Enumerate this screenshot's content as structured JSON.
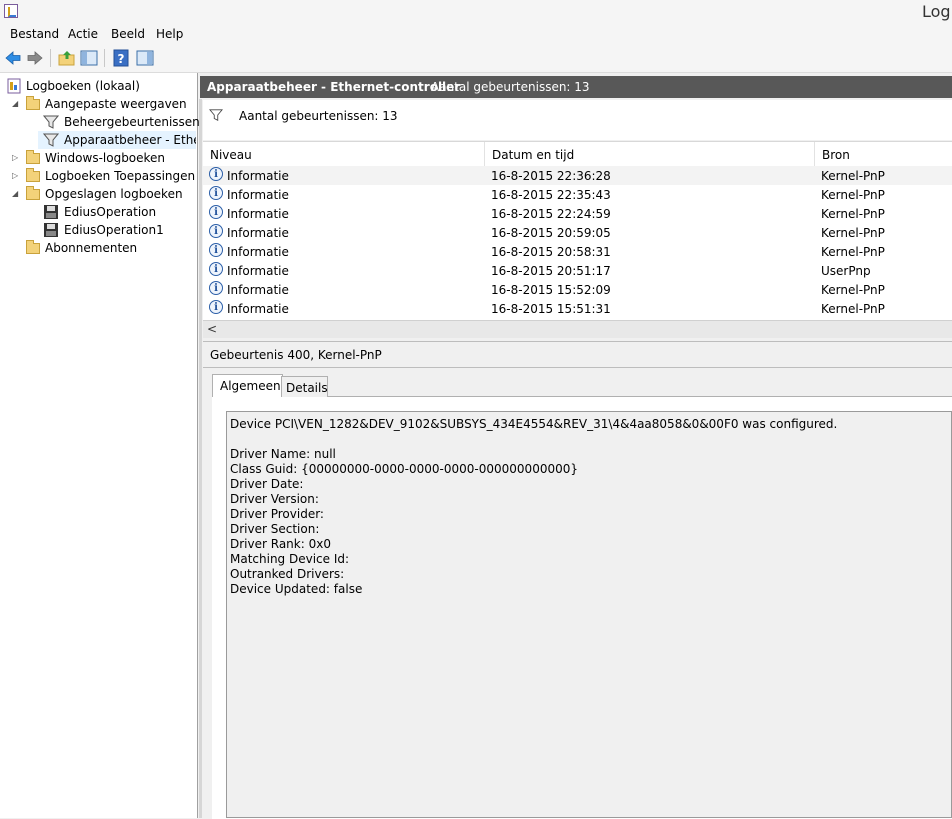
{
  "window": {
    "title": "Logb"
  },
  "menu": {
    "items": [
      "Bestand",
      "Actie",
      "Beeld",
      "Help"
    ]
  },
  "toolbar": {
    "icons": [
      "back-arrow-icon",
      "forward-arrow-icon",
      "up-folder-icon",
      "show-hide-tree-icon",
      "help-icon",
      "action-pane-icon"
    ]
  },
  "tree": {
    "items": [
      {
        "label": "Logboeken (lokaal)",
        "icon": "event-viewer-icon"
      },
      {
        "label": "Aangepaste weergaven",
        "icon": "folder-icon"
      },
      {
        "label": "Beheergebeurtenissen",
        "icon": "filter-icon"
      },
      {
        "label": "Apparaatbeheer - Ethernet",
        "icon": "filter-icon"
      },
      {
        "label": "Windows-logboeken",
        "icon": "folder-icon"
      },
      {
        "label": "Logboeken Toepassingen en",
        "icon": "folder-icon"
      },
      {
        "label": "Opgeslagen logboeken",
        "icon": "folder-icon"
      },
      {
        "label": "EdiusOperation",
        "icon": "disk-icon"
      },
      {
        "label": "EdiusOperation1",
        "icon": "disk-icon"
      },
      {
        "label": "Abonnementen",
        "icon": "folder-icon"
      }
    ]
  },
  "panel": {
    "title": "Apparaatbeheer - Ethernet-controller",
    "count_label": "Aantal gebeurtenissen: 13",
    "filter_text": "Aantal gebeurtenissen: 13"
  },
  "grid": {
    "columns": [
      "Niveau",
      "Datum en tijd",
      "Bron"
    ],
    "rows": [
      {
        "level": "Informatie",
        "datetime": "16-8-2015 22:36:28",
        "source": "Kernel-PnP"
      },
      {
        "level": "Informatie",
        "datetime": "16-8-2015 22:35:43",
        "source": "Kernel-PnP"
      },
      {
        "level": "Informatie",
        "datetime": "16-8-2015 22:24:59",
        "source": "Kernel-PnP"
      },
      {
        "level": "Informatie",
        "datetime": "16-8-2015 20:59:05",
        "source": "Kernel-PnP"
      },
      {
        "level": "Informatie",
        "datetime": "16-8-2015 20:58:31",
        "source": "Kernel-PnP"
      },
      {
        "level": "Informatie",
        "datetime": "16-8-2015 20:51:17",
        "source": "UserPnp"
      },
      {
        "level": "Informatie",
        "datetime": "16-8-2015 15:52:09",
        "source": "Kernel-PnP"
      },
      {
        "level": "Informatie",
        "datetime": "16-8-2015 15:51:31",
        "source": "Kernel-PnP"
      }
    ],
    "scroll_left_arrow": "<"
  },
  "detail": {
    "header": "Gebeurtenis 400, Kernel-PnP",
    "tabs": [
      "Algemeen",
      "Details"
    ],
    "lines": [
      "Device PCI\\VEN_1282&DEV_9102&SUBSYS_434E4554&REV_31\\4&4aa8058&0&00F0 was configured.",
      "",
      "Driver Name: null",
      "Class Guid: {00000000-0000-0000-0000-000000000000}",
      "Driver Date:",
      "Driver Version:",
      "Driver Provider:",
      "Driver Section:",
      "Driver Rank: 0x0",
      "Matching Device Id:",
      "Outranked Drivers:",
      "Device Updated: false"
    ]
  }
}
